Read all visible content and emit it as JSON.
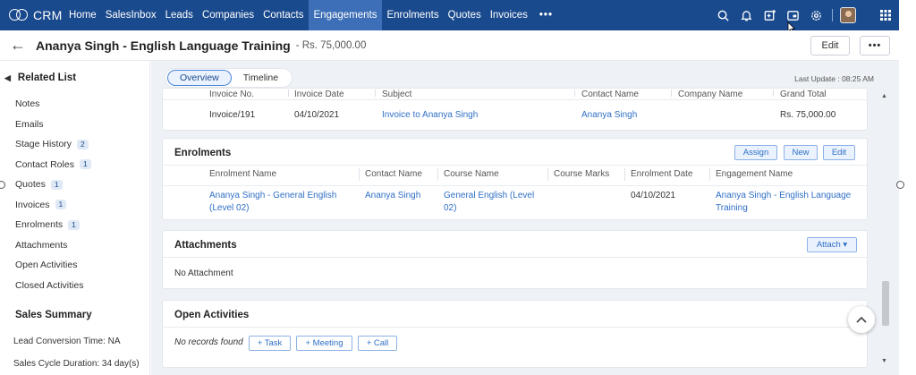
{
  "app": {
    "logo_text": "CRM"
  },
  "nav": {
    "tabs": [
      "Home",
      "SalesInbox",
      "Leads",
      "Companies",
      "Contacts",
      "Engagements",
      "Enrolments",
      "Quotes",
      "Invoices",
      "•••"
    ],
    "active_tab": "Engagements",
    "icons": [
      "search-icon",
      "bell-icon",
      "calendar-add-icon",
      "screen-share-icon",
      "settings-icon",
      "avatar",
      "apps-grid-icon"
    ]
  },
  "record": {
    "title": "Ananya Singh - English Language Training",
    "amount": "- Rs. 75,000.00",
    "edit_label": "Edit",
    "more_label": "•••"
  },
  "sidebar": {
    "heading": "Related List",
    "items": [
      {
        "label": "Notes",
        "count": ""
      },
      {
        "label": "Emails",
        "count": ""
      },
      {
        "label": "Stage History",
        "count": "2"
      },
      {
        "label": "Contact Roles",
        "count": "1"
      },
      {
        "label": "Quotes",
        "count": "1"
      },
      {
        "label": "Invoices",
        "count": "1"
      },
      {
        "label": "Enrolments",
        "count": "1"
      },
      {
        "label": "Attachments",
        "count": ""
      },
      {
        "label": "Open Activities",
        "count": ""
      },
      {
        "label": "Closed Activities",
        "count": ""
      }
    ],
    "summary_heading": "Sales Summary",
    "lead_conversion": "Lead Conversion Time: NA",
    "sales_cycle": "Sales Cycle Duration: 34 day(s)"
  },
  "main": {
    "tabs": [
      "Overview",
      "Timeline"
    ],
    "active_tab": "Overview",
    "last_update": "Last Update : 08:25 AM"
  },
  "invoices": {
    "columns": [
      "Invoice No.",
      "Invoice Date",
      "Subject",
      "Contact Name",
      "Company Name",
      "Grand Total"
    ],
    "row": {
      "invoice_no": "Invoice/191",
      "invoice_date": "04/10/2021",
      "subject": "Invoice to Ananya Singh",
      "contact_name": "Ananya Singh",
      "company_name": "",
      "grand_total": "Rs. 75,000.00"
    }
  },
  "enrolments": {
    "title": "Enrolments",
    "buttons": {
      "assign": "Assign",
      "new": "New",
      "edit": "Edit"
    },
    "columns": [
      "Enrolment Name",
      "Contact Name",
      "Course Name",
      "Course Marks",
      "Enrolment Date",
      "Engagement Name"
    ],
    "row": {
      "enrolment_name_l1": "Ananya Singh - General English",
      "enrolment_name_l2": "(Level 02)",
      "contact_name": "Ananya Singh",
      "course_name_l1": "General English (Level",
      "course_name_l2": "02)",
      "course_marks": "",
      "enrolment_date": "04/10/2021",
      "engagement_name_l1": "Ananya Singh - English Language",
      "engagement_name_l2": "Training"
    }
  },
  "attachments": {
    "title": "Attachments",
    "attach_button": "Attach ▾",
    "empty_text": "No Attachment"
  },
  "open_activities": {
    "title": "Open Activities",
    "empty_text": "No records found",
    "buttons": {
      "task": "+ Task",
      "meeting": "+ Meeting",
      "call": "+ Call"
    }
  },
  "colors": {
    "nav_bg": "#1a4a8e",
    "nav_active": "#3c6fb7",
    "link": "#2f6fc6",
    "page_bg": "#eef1f5"
  }
}
